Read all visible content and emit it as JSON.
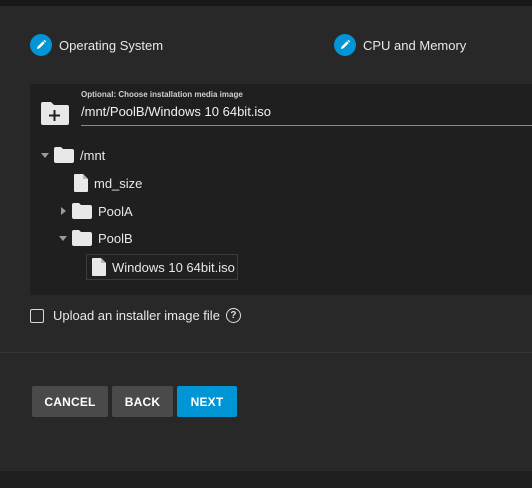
{
  "stepper": {
    "steps": [
      {
        "label": "Operating System",
        "icon": "pencil-icon"
      },
      {
        "label": "CPU and Memory",
        "icon": "pencil-icon"
      }
    ],
    "accent_color": "#0095d5"
  },
  "explorer": {
    "field_label": "Optional: Choose installation media image",
    "path_value": "/mnt/PoolB/Windows 10 64bit.iso",
    "tree": [
      {
        "label": "/mnt",
        "type": "folder",
        "expanded": true
      },
      {
        "label": "md_size",
        "type": "file"
      },
      {
        "label": "PoolA",
        "type": "folder",
        "expanded": false
      },
      {
        "label": "PoolB",
        "type": "folder",
        "expanded": true
      },
      {
        "label": "Windows 10 64bit.iso",
        "type": "file",
        "selected": true
      }
    ]
  },
  "upload": {
    "label": "Upload an installer image file",
    "checked": false,
    "help": "?"
  },
  "actions": {
    "cancel": "CANCEL",
    "back": "BACK",
    "next": "NEXT"
  }
}
